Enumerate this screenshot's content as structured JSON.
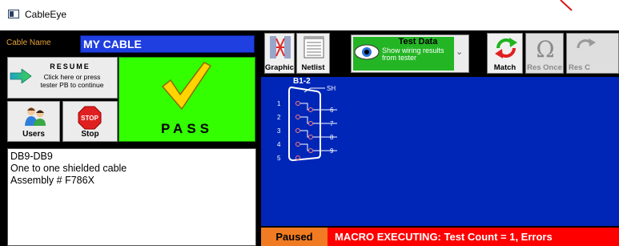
{
  "window": {
    "title": "CableEye"
  },
  "cable": {
    "name_label": "Cable Name",
    "name_value": "MY CABLE"
  },
  "resume": {
    "title": "RESUME",
    "line1": "Click here or press",
    "line2": "tester PB to continue"
  },
  "buttons": {
    "users": "Users",
    "stop": "Stop",
    "stop_sign": "STOP"
  },
  "result": {
    "label": "PASS",
    "color": "#33ff00"
  },
  "notes": [
    "DB9-DB9",
    "One to one shielded cable",
    "Assembly # F786X"
  ],
  "toolbar": {
    "graphic": "Graphic",
    "netlist": "Netlist",
    "test_data_title": "Test Data",
    "test_data_sub1": "Show wiring results",
    "test_data_sub2": "from tester",
    "match": "Match",
    "res_once": "Res Once",
    "res_c": "Res C"
  },
  "diagram": {
    "connector_label": "B1-2",
    "shield_label": "SH",
    "pins": [
      "1",
      "2",
      "3",
      "4",
      "5"
    ],
    "wires": [
      "6",
      "7",
      "8",
      "9"
    ]
  },
  "status": {
    "state": "Paused",
    "message": "MACRO EXECUTING:  Test Count = 1,  Errors"
  },
  "colors": {
    "canvas": "#0026b8",
    "status_bar": "#ff0000",
    "paused": "#f07b22",
    "name_field": "#1f3fe0",
    "test_data": "#24b525"
  }
}
